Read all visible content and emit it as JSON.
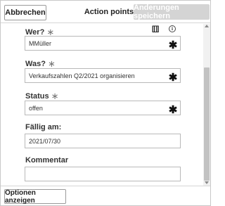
{
  "toolbar": {
    "cancel_label": "Abbrechen",
    "title": "Action points",
    "save_label": "Änderungen speichern"
  },
  "form": {
    "who": {
      "label": "Wer?",
      "value": "MMüller",
      "required_mark": "∗",
      "input_mark": "✱"
    },
    "what": {
      "label": "Was?",
      "value": "Verkaufszahlen Q2/2021 organisieren",
      "required_mark": "∗",
      "input_mark": "✱"
    },
    "status": {
      "label": "Status",
      "value": "offen",
      "required_mark": "∗",
      "input_mark": "✱"
    },
    "due": {
      "label": "Fällig am:",
      "value": "2021/07/30"
    },
    "comment": {
      "label": "Kommentar",
      "value": ""
    }
  },
  "icons": {
    "bracket": "[[]]",
    "info": "i"
  },
  "footer": {
    "options_label": "Optionen anzeigen"
  }
}
